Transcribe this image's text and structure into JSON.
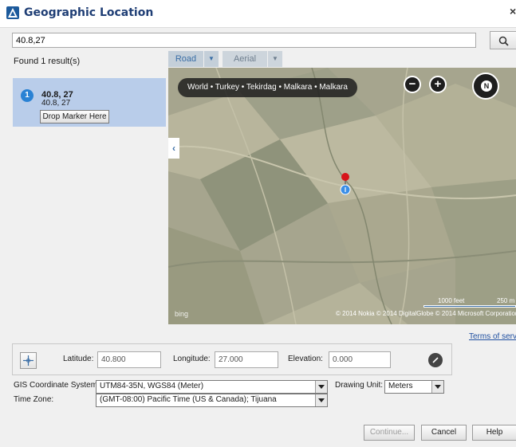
{
  "window": {
    "title": "Geographic Location",
    "close_glyph": "×"
  },
  "search": {
    "value": "40.8,27",
    "icon": "search-icon"
  },
  "results": {
    "count_label": "Found 1 result(s)",
    "items": [
      {
        "index": "1",
        "title": "40.8, 27",
        "subtitle": "40.8, 27",
        "drop_label": "Drop Marker Here"
      }
    ]
  },
  "map": {
    "tabs": [
      {
        "label": "Road",
        "active": true
      },
      {
        "label": "Aerial",
        "active": false
      }
    ],
    "breadcrumb": "World • Turkey • Tekirdag • Malkara • Malkara",
    "zoom_out": "−",
    "zoom_in": "+",
    "compass_label": "N",
    "collapse_glyph": "‹",
    "bing_label": "bing",
    "copyright": "© 2014 Nokia   © 2014 DigitalGlobe   © 2014 Microsoft Corporation",
    "scale_feet": "1000 feet",
    "scale_meters": "250 m",
    "terms_label": "Terms of service"
  },
  "coordinates": {
    "latitude_label": "Latitude:",
    "latitude_value": "40.800",
    "longitude_label": "Longitude:",
    "longitude_value": "27.000",
    "elevation_label": "Elevation:",
    "elevation_value": "0.000"
  },
  "settings": {
    "gis_label": "GIS Coordinate System:",
    "gis_value": "UTM84-35N, WGS84 (Meter)",
    "drawing_unit_label": "Drawing Unit:",
    "drawing_unit_value": "Meters",
    "timezone_label": "Time Zone:",
    "timezone_value": "(GMT-08:00) Pacific Time (US & Canada); Tijuana"
  },
  "buttons": {
    "continue": "Continue...",
    "cancel": "Cancel",
    "help": "Help"
  },
  "colors": {
    "title_text": "#1f3e75",
    "result_highlight": "#b9cdea",
    "badge": "#2a82d4",
    "pin": "#d7141a",
    "location_dot": "#3a8ee6",
    "link": "#1f4fa0"
  }
}
